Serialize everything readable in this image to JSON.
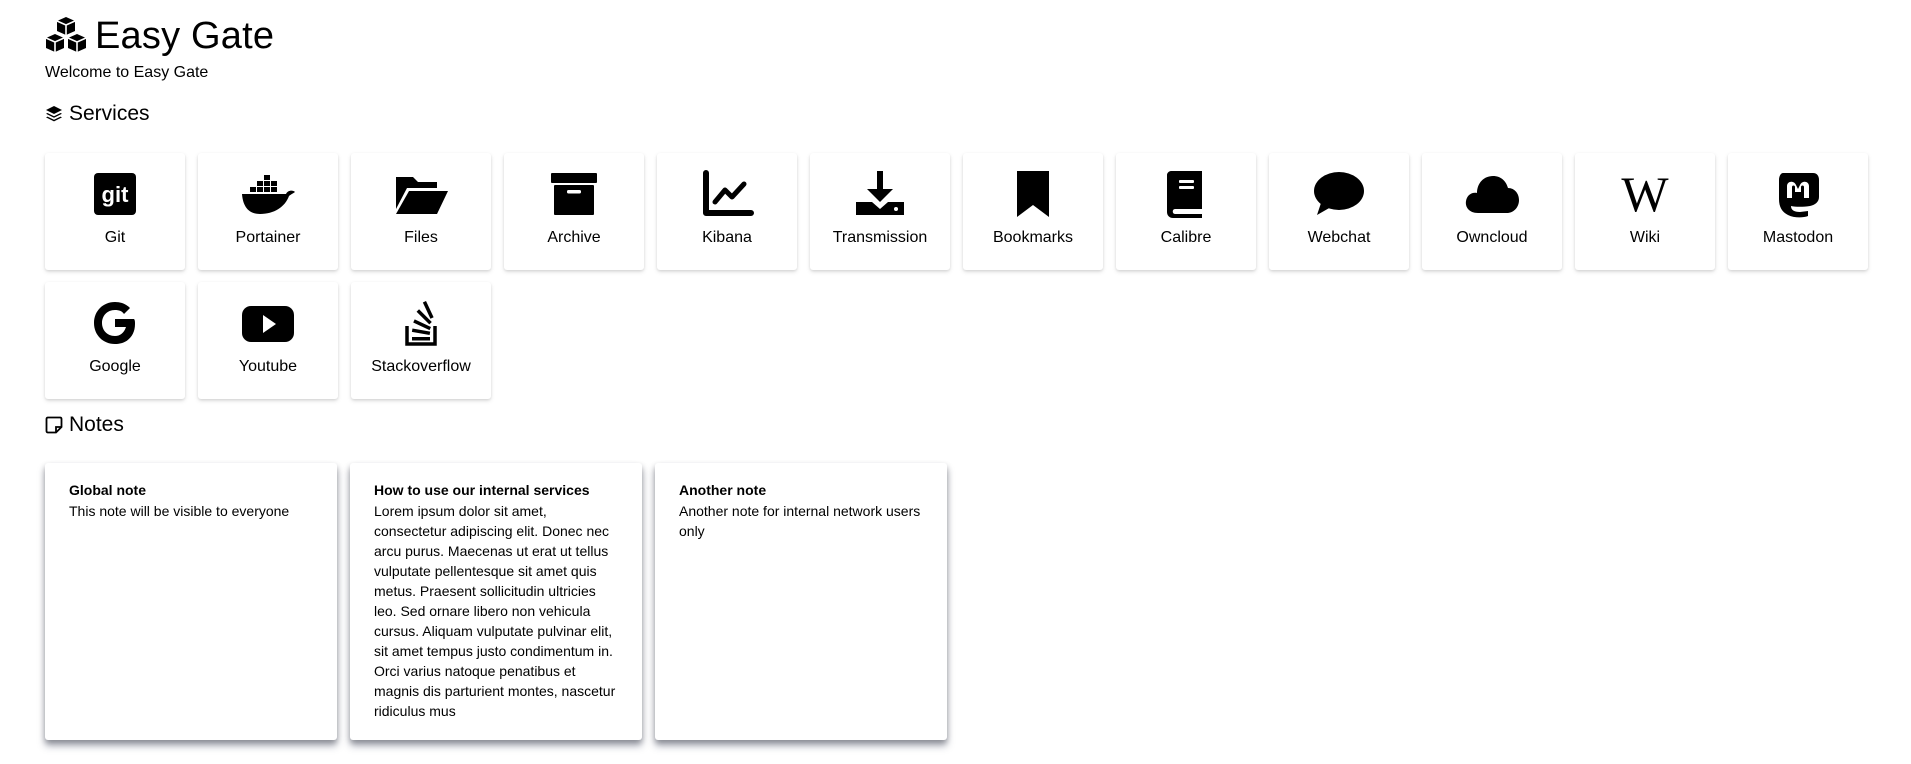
{
  "app": {
    "title": "Easy Gate",
    "subtitle": "Welcome to Easy Gate",
    "logo_icon": "cubes-icon"
  },
  "services": {
    "heading": "Services",
    "heading_icon": "layer-group-icon",
    "items": [
      {
        "label": "Git",
        "icon": "git-icon"
      },
      {
        "label": "Portainer",
        "icon": "docker-icon"
      },
      {
        "label": "Files",
        "icon": "folder-open-icon"
      },
      {
        "label": "Archive",
        "icon": "archive-box-icon"
      },
      {
        "label": "Kibana",
        "icon": "chart-line-icon"
      },
      {
        "label": "Transmission",
        "icon": "download-icon"
      },
      {
        "label": "Bookmarks",
        "icon": "bookmark-icon"
      },
      {
        "label": "Calibre",
        "icon": "book-icon"
      },
      {
        "label": "Webchat",
        "icon": "comment-icon"
      },
      {
        "label": "Owncloud",
        "icon": "cloud-icon"
      },
      {
        "label": "Wiki",
        "icon": "wikipedia-icon"
      },
      {
        "label": "Mastodon",
        "icon": "mastodon-icon"
      },
      {
        "label": "Google",
        "icon": "google-icon"
      },
      {
        "label": "Youtube",
        "icon": "youtube-icon"
      },
      {
        "label": "Stackoverflow",
        "icon": "stackoverflow-icon"
      }
    ]
  },
  "notes": {
    "heading": "Notes",
    "heading_icon": "sticky-note-icon",
    "items": [
      {
        "title": "Global note",
        "body": "This note will be visible to everyone"
      },
      {
        "title": "How to use our internal services",
        "body": "Lorem ipsum dolor sit amet, consectetur adipiscing elit. Donec nec arcu purus. Maecenas ut erat ut tellus vulputate pellentesque sit amet quis metus. Praesent sollicitudin ultricies leo. Sed ornare libero non vehicula cursus. Aliquam vulputate pulvinar elit, sit amet tempus justo condimentum in. Orci varius natoque penatibus et magnis dis parturient montes, nascetur ridiculus mus"
      },
      {
        "title": "Another note",
        "body": "Another note for internal network users only"
      }
    ]
  }
}
